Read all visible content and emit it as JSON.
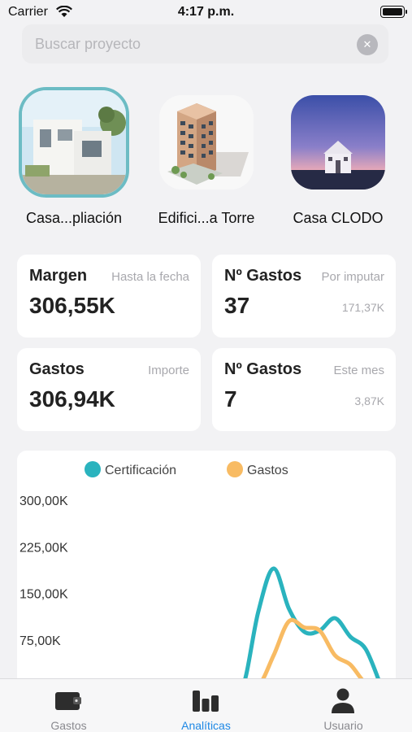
{
  "status_bar": {
    "carrier": "Carrier",
    "time": "4:17 p.m."
  },
  "search": {
    "placeholder": "Buscar proyecto",
    "value": ""
  },
  "projects": [
    {
      "name": "Casa...pliación",
      "selected": true
    },
    {
      "name": "Edifici...a Torre",
      "selected": false
    },
    {
      "name": "Casa CLODO",
      "selected": false
    }
  ],
  "cards": [
    {
      "title": "Margen",
      "subtitle": "Hasta la fecha",
      "value": "306,55K",
      "extra": ""
    },
    {
      "title": "Nº Gastos",
      "subtitle": "Por imputar",
      "value": "37",
      "extra": "171,37K"
    },
    {
      "title": "Gastos",
      "subtitle": "Importe",
      "value": "306,94K",
      "extra": ""
    },
    {
      "title": "Nº Gastos",
      "subtitle": "Este mes",
      "value": "7",
      "extra": "3,87K"
    }
  ],
  "chart_data": {
    "type": "line",
    "legend_position": "top",
    "grid": false,
    "ylim": [
      0,
      300000
    ],
    "yticks": [
      "300,00K",
      "225,00K",
      "150,00K",
      "75,00K"
    ],
    "series": [
      {
        "name": "Certificación",
        "color": "#2ab3be",
        "x": [
          0,
          1,
          2,
          3,
          4,
          5,
          6,
          7,
          8,
          9,
          10,
          11,
          12,
          13,
          14,
          15,
          16,
          17,
          18,
          19,
          20
        ],
        "values": [
          0,
          0,
          0,
          0,
          0,
          0,
          0,
          0,
          0,
          0,
          0,
          0,
          120000,
          190000,
          125000,
          88000,
          90000,
          110000,
          80000,
          60000,
          0
        ]
      },
      {
        "name": "Gastos",
        "color": "#f8bb63",
        "x": [
          0,
          1,
          2,
          3,
          4,
          5,
          6,
          7,
          8,
          9,
          10,
          11,
          12,
          13,
          14,
          15,
          16,
          17,
          18,
          19,
          20
        ],
        "values": [
          0,
          0,
          0,
          0,
          0,
          0,
          0,
          0,
          0,
          0,
          0,
          0,
          0,
          50000,
          105000,
          95000,
          90000,
          50000,
          35000,
          5000,
          0
        ]
      }
    ]
  },
  "tabs": [
    {
      "label": "Gastos",
      "icon": "wallet-icon",
      "active": false
    },
    {
      "label": "Analíticas",
      "icon": "bar-chart-icon",
      "active": true
    },
    {
      "label": "Usuario",
      "icon": "user-icon",
      "active": false
    }
  ],
  "colors": {
    "accent": "#1e88e5",
    "selected_ring": "#6cbcc4"
  }
}
